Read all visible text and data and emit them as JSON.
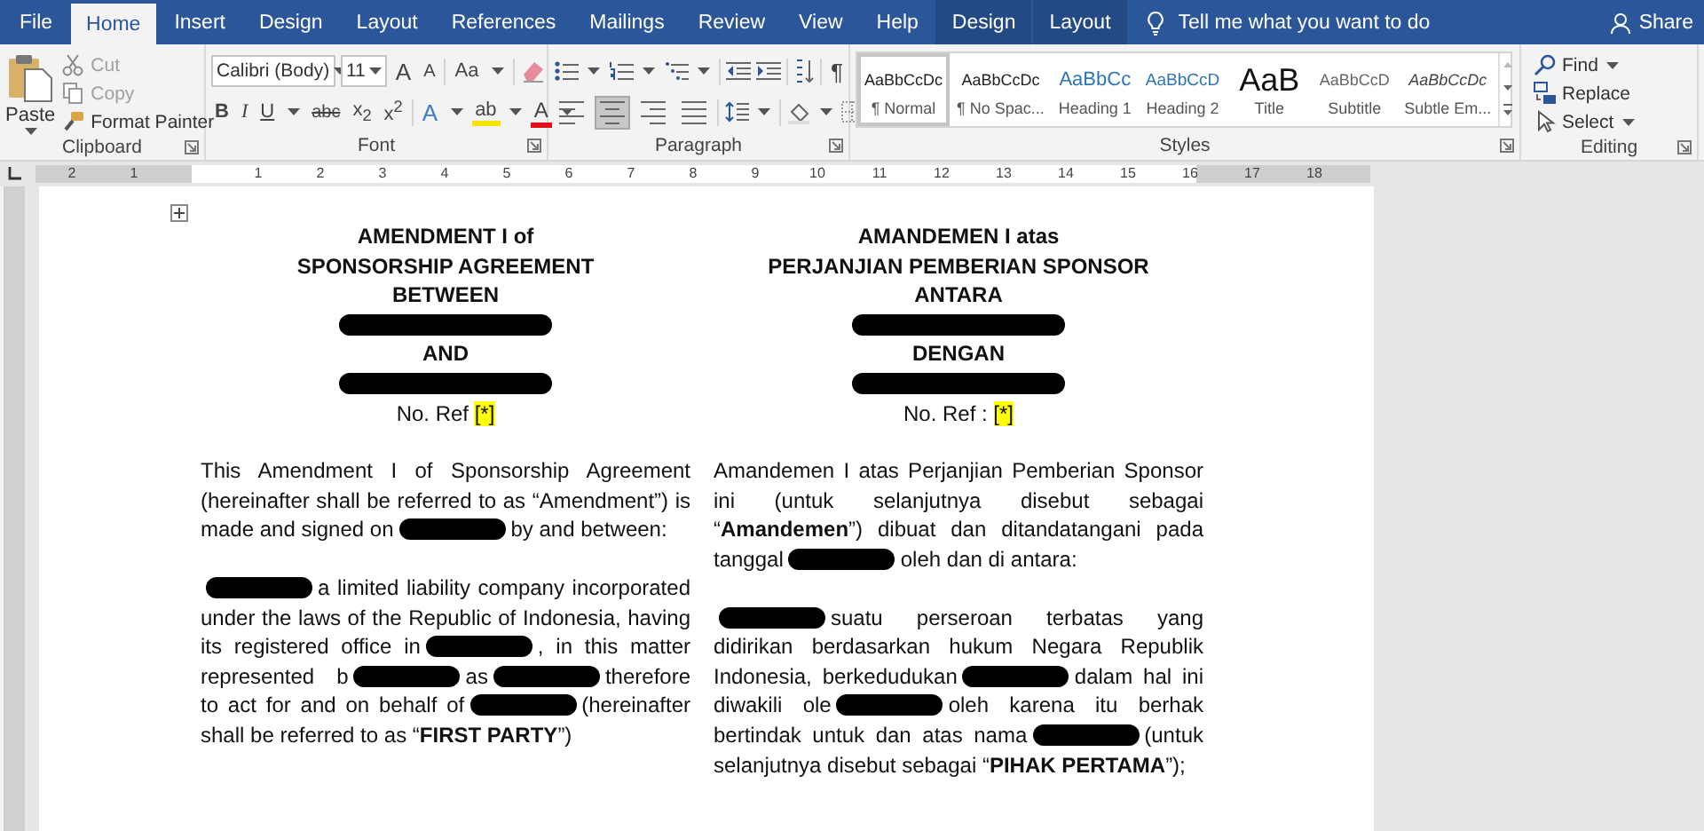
{
  "tabs": [
    {
      "label": "File",
      "kind": "plain",
      "selected": false
    },
    {
      "label": "Home",
      "kind": "plain",
      "selected": true
    },
    {
      "label": "Insert",
      "kind": "plain",
      "selected": false
    },
    {
      "label": "Design",
      "kind": "plain",
      "selected": false
    },
    {
      "label": "Layout",
      "kind": "plain",
      "selected": false
    },
    {
      "label": "References",
      "kind": "plain",
      "selected": false
    },
    {
      "label": "Mailings",
      "kind": "plain",
      "selected": false
    },
    {
      "label": "Review",
      "kind": "plain",
      "selected": false
    },
    {
      "label": "View",
      "kind": "plain",
      "selected": false
    },
    {
      "label": "Help",
      "kind": "plain",
      "selected": false
    },
    {
      "label": "Design",
      "kind": "contextual",
      "selected": false
    },
    {
      "label": "Layout",
      "kind": "contextual",
      "selected": false
    }
  ],
  "tell_me": {
    "placeholder": "Tell me what you want to do"
  },
  "share": "Share",
  "ribbon": {
    "clipboard": {
      "label": "Clipboard",
      "paste": "Paste",
      "items": [
        {
          "label": "Cut",
          "kind": "cut",
          "disabled": true
        },
        {
          "label": "Copy",
          "kind": "copy",
          "disabled": true
        },
        {
          "label": "Format Painter",
          "kind": "painter",
          "disabled": false
        }
      ]
    },
    "font": {
      "label": "Font",
      "font_name": "Calibri (Body)",
      "font_size": "11",
      "grow": "A",
      "shrink": "A",
      "change_case": "Aa",
      "format_buttons": [
        {
          "label": "B",
          "kind": "bold"
        },
        {
          "label": "I",
          "kind": "italic"
        },
        {
          "label": "U",
          "kind": "underline"
        },
        {
          "label": "abc",
          "kind": "strike"
        },
        {
          "label": "x$_{2}$",
          "kind": "subscript"
        },
        {
          "label": "x$^{2}$",
          "kind": "superscript"
        }
      ],
      "effects": "A",
      "highlight": "ab",
      "font_color": "A"
    },
    "paragraph": {
      "label": "Paragraph",
      "pilcrow": "¶",
      "alignment": [
        {
          "kind": "left",
          "selected": false
        },
        {
          "kind": "center",
          "selected": true
        },
        {
          "kind": "right",
          "selected": false
        },
        {
          "kind": "justify",
          "selected": false
        }
      ]
    },
    "styles": {
      "label": "Styles",
      "items": [
        {
          "preview": "AaBbCcDc",
          "name": "¶ Normal",
          "kind": "normal",
          "selected": true
        },
        {
          "preview": "AaBbCcDc",
          "name": "¶ No Spac...",
          "kind": "nospacing",
          "selected": false
        },
        {
          "preview": "AaBbCc",
          "name": "Heading 1",
          "kind": "heading1",
          "selected": false
        },
        {
          "preview": "AaBbCcD",
          "name": "Heading 2",
          "kind": "heading2",
          "selected": false
        },
        {
          "preview": "AaB",
          "name": "Title",
          "kind": "title",
          "selected": false
        },
        {
          "preview": "AaBbCcD",
          "name": "Subtitle",
          "kind": "subtitle",
          "selected": false
        },
        {
          "preview": "AaBbCcDc",
          "name": "Subtle Em...",
          "kind": "subtle",
          "selected": false
        }
      ]
    },
    "editing": {
      "label": "Editing",
      "items": [
        {
          "label": "Find",
          "kind": "find"
        },
        {
          "label": "Replace",
          "kind": "replace"
        },
        {
          "label": "Select",
          "kind": "select"
        }
      ]
    }
  },
  "ruler": {
    "left_numbers": [
      "2",
      "1"
    ],
    "numbers": [
      "1",
      "2",
      "3",
      "4",
      "5",
      "6",
      "7",
      "8",
      "9",
      "10",
      "11",
      "12",
      "13",
      "14",
      "15",
      "16",
      "17",
      "18"
    ]
  },
  "document": {
    "columns": [
      {
        "blocks": [
          {
            "kind": "heading",
            "text": "AMENDMENT I of"
          },
          {
            "kind": "heading",
            "text": "SPONSORSHIP AGREEMENT"
          },
          {
            "kind": "heading",
            "text": "BETWEEN"
          },
          {
            "kind": "redaction"
          },
          {
            "kind": "heading",
            "text": "AND"
          },
          {
            "kind": "redaction"
          },
          {
            "kind": "ref",
            "segments": [
              {
                "kind": "text",
                "text": "No. Ref "
              },
              {
                "kind": "text",
                "text": "[*]",
                "highlight": true
              }
            ]
          },
          {
            "kind": "paragraph",
            "segments": [
              {
                "kind": "text",
                "text": "This Amendment I of Sponsorship Agreement (hereinafter shall be referred to as “Amendment”) is made and signed on"
              },
              {
                "kind": "redaction"
              },
              {
                "kind": "text",
                "text": "by and between:"
              }
            ]
          },
          {
            "kind": "paragraph",
            "segments": [
              {
                "kind": "redaction"
              },
              {
                "kind": "text",
                "text": "a limited liability company incorporated under the laws of the Republic of Indonesia, having its registered office in"
              },
              {
                "kind": "redaction"
              },
              {
                "kind": "text",
                "text": ", in this matter represented b"
              },
              {
                "kind": "redaction"
              },
              {
                "kind": "text",
                "text": "as"
              },
              {
                "kind": "redaction"
              },
              {
                "kind": "text",
                "text": "therefore to act for and on behalf of"
              },
              {
                "kind": "redaction"
              },
              {
                "kind": "text",
                "text": "(hereinafter shall be referred to as “**FIRST PARTY**”)"
              }
            ]
          }
        ]
      },
      {
        "blocks": [
          {
            "kind": "heading",
            "text": "AMANDEMEN I atas"
          },
          {
            "kind": "heading",
            "text": "PERJANJIAN PEMBERIAN SPONSOR"
          },
          {
            "kind": "heading",
            "text": "ANTARA"
          },
          {
            "kind": "redaction"
          },
          {
            "kind": "heading",
            "text": "DENGAN"
          },
          {
            "kind": "redaction"
          },
          {
            "kind": "ref",
            "segments": [
              {
                "kind": "text",
                "text": "No. Ref : "
              },
              {
                "kind": "text",
                "text": "[*]",
                "highlight": true
              }
            ]
          },
          {
            "kind": "paragraph",
            "segments": [
              {
                "kind": "text",
                "text": "Amandemen I atas Perjanjian Pemberian Sponsor ini (untuk selanjutnya disebut sebagai “**Amandemen**”) dibuat dan ditandatangani pada tanggal"
              },
              {
                "kind": "redaction"
              },
              {
                "kind": "text",
                "text": "oleh dan di antara:"
              }
            ]
          },
          {
            "kind": "paragraph",
            "segments": [
              {
                "kind": "redaction"
              },
              {
                "kind": "text",
                "text": "suatu perseroan terbatas yang didirikan berdasarkan hukum Negara Republik Indonesia, berkedudukan"
              },
              {
                "kind": "redaction"
              },
              {
                "kind": "text",
                "text": "dalam hal ini diwakili ole"
              },
              {
                "kind": "redaction"
              },
              {
                "kind": "text",
                "text": "oleh karena itu berhak bertindak untuk dan atas nama"
              },
              {
                "kind": "redaction"
              },
              {
                "kind": "text",
                "text": "(untuk selanjutnya disebut sebagai “**PIHAK PERTAMA**”);"
              }
            ]
          }
        ]
      }
    ]
  }
}
